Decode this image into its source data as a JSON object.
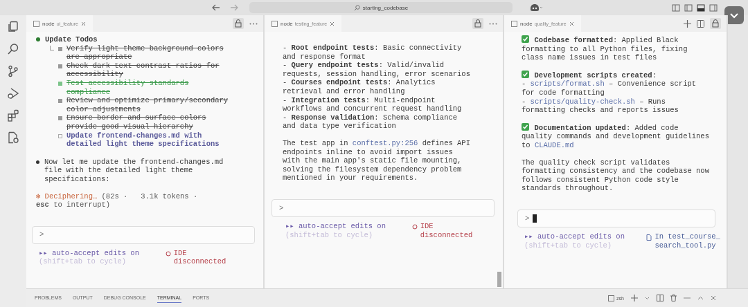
{
  "titlebar": {
    "search": "starting_codebase"
  },
  "panes": [
    {
      "tab": {
        "prefix": "node",
        "name": "ui_feature"
      },
      "tab_actions": [
        {
          "kind": "lock"
        },
        {
          "kind": "more"
        }
      ],
      "blocks": [
        {
          "kind": "todos",
          "title": "Update Todos",
          "items": [
            {
              "text": "Verify light theme background colors are appropriate",
              "checked": true,
              "highlighted": false
            },
            {
              "text": "Check dark text contrast ratios for accessibility",
              "checked": true,
              "highlighted": false
            },
            {
              "text": "Test accessibility standards compliance",
              "checked": true,
              "highlighted": true
            },
            {
              "text": "Review and optimize primary/secondary color adjustments",
              "checked": true,
              "highlighted": false
            },
            {
              "text": "Ensure border and surface colors provide good visual hierarchy",
              "checked": true,
              "highlighted": false
            },
            {
              "text": "Update frontend-changes.md with detailed light theme specifications",
              "checked": false,
              "highlighted": false
            }
          ]
        },
        {
          "kind": "bullet",
          "segments": [
            {
              "kind": "text",
              "text": "Now let me update the frontend-changes.md file with the detailed light theme specifications:"
            }
          ]
        },
        {
          "kind": "spinner",
          "symbol": "✻",
          "label": "Deciphering…",
          "detail": "(82s ·   3.1k tokens · **esc** to interrupt)"
        }
      ],
      "prompt": {
        "symbol": ">",
        "cursor": false
      },
      "status": {
        "mode": "▸▸ auto-accept edits on",
        "hint": "(shift+tab to cycle)",
        "ide": {
          "kind": "disconnected",
          "text": "IDE disconnected"
        }
      }
    },
    {
      "tab": {
        "prefix": "node",
        "name": "testing_feature"
      },
      "tab_actions": [
        {
          "kind": "lock"
        },
        {
          "kind": "more"
        }
      ],
      "blocks": [
        {
          "kind": "lines",
          "lines": [
            "- **Root endpoint tests**: Basic connectivity and response format",
            "- **Query endpoint tests**: Valid/invalid requests, session handling, error scenarios",
            "- **Courses endpoint tests**: Analytics retrieval and error handling",
            "- **Integration tests**: Multi-endpoint workflows and concurrent request handling",
            "- **Response validation**: Schema compliance and data type verification"
          ]
        },
        {
          "kind": "paragraph",
          "segments": [
            {
              "kind": "text",
              "text": "The test app in "
            },
            {
              "kind": "link",
              "text": "conftest.py:256"
            },
            {
              "kind": "text",
              "text": " defines API  endpoints inline to avoid import issues with the main app's static file mounting, solving the filesystem dependency problem mentioned in your requirements."
            }
          ]
        }
      ],
      "prompt": {
        "symbol": ">",
        "cursor": false
      },
      "status": {
        "mode": "▸▸ auto-accept edits on",
        "hint": "(shift+tab to cycle)",
        "ide": {
          "kind": "disconnected",
          "text": "IDE disconnected"
        }
      }
    },
    {
      "tab": {
        "prefix": "node",
        "name": "quality_feature"
      },
      "tab_actions": [
        {
          "kind": "add"
        },
        {
          "kind": "split"
        },
        {
          "kind": "lock"
        }
      ],
      "blocks": [
        {
          "kind": "check",
          "checked": true,
          "segments": [
            {
              "kind": "text",
              "text": "**Codebase formatted**: Applied Black formatting to all Python files, fixing class name issues in test files"
            }
          ]
        },
        {
          "kind": "check",
          "checked": true,
          "segments": [
            {
              "kind": "text",
              "text": "**Development scripts created**:"
            }
          ],
          "sublines": [
            [
              {
                "kind": "text",
                "text": "- "
              },
              {
                "kind": "link",
                "text": "scripts/format.sh"
              },
              {
                "kind": "text",
                "text": " – Convenience script for code formatting"
              }
            ],
            [
              {
                "kind": "text",
                "text": "- "
              },
              {
                "kind": "link",
                "text": "scripts/quality-check.sh"
              },
              {
                "kind": "text",
                "text": " – Runs formatting checks and reports issues"
              }
            ]
          ]
        },
        {
          "kind": "check",
          "checked": true,
          "segments": [
            {
              "kind": "text",
              "text": "**Documentation updated**: Added code quality commands and development guidelines  to "
            },
            {
              "kind": "link",
              "text": "CLAUDE.md"
            }
          ]
        },
        {
          "kind": "paragraph",
          "segments": [
            {
              "kind": "text",
              "text": "The quality check script validates formatting consistency and the codebase now  follows consistent Python code style standards throughout."
            }
          ]
        }
      ],
      "prompt": {
        "symbol": ">",
        "cursor": true
      },
      "status": {
        "mode": "▸▸ auto-accept edits on",
        "hint": "(shift+tab to cycle)",
        "ide": {
          "kind": "file",
          "text": "In test_course_search_tool.py"
        }
      }
    }
  ],
  "panel_tabs": [
    {
      "label": "PROBLEMS",
      "selected": false
    },
    {
      "label": "OUTPUT",
      "selected": false
    },
    {
      "label": "DEBUG CONSOLE",
      "selected": false
    },
    {
      "label": "TERMINAL",
      "selected": true
    },
    {
      "label": "PORTS",
      "selected": false
    }
  ],
  "terminal": {
    "shell": "zsh"
  }
}
